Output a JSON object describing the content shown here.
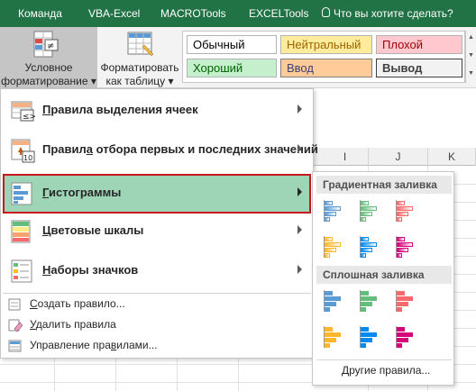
{
  "tabs": [
    {
      "label": "Команда"
    },
    {
      "label": "VBA-Excel"
    },
    {
      "label": "MACROTools"
    },
    {
      "label": "EXCELTools"
    }
  ],
  "tell_me": "Что вы хотите сделать?",
  "ribbon": {
    "conditional_formatting": {
      "line1": "Условное",
      "line2": "форматирование ▾"
    },
    "format_as_table": {
      "line1": "Форматировать",
      "line2": "как таблицу ▾"
    },
    "cell_styles": [
      {
        "label": "Обычный",
        "bg": "#ffffff",
        "color": "#000000"
      },
      {
        "label": "Нейтральный",
        "bg": "#ffeb9c",
        "color": "#9c6500"
      },
      {
        "label": "Плохой",
        "bg": "#ffc7ce",
        "color": "#9c0006"
      },
      {
        "label": "Хороший",
        "bg": "#c6efce",
        "color": "#006100"
      },
      {
        "label": "Ввод",
        "bg": "#ffcc99",
        "color": "#3f3f76"
      },
      {
        "label": "Вывод",
        "bg": "#f2f2f2",
        "color": "#3f3f3f"
      }
    ]
  },
  "sheet": {
    "columns": [
      {
        "label": "I"
      },
      {
        "label": "J"
      },
      {
        "label": "K"
      }
    ]
  },
  "menu": {
    "items": [
      {
        "label": "Правила выделения ячеек",
        "icon": "highlight-rules-icon"
      },
      {
        "label": "Правила отбора первых и последних значений",
        "icon": "top-bottom-rules-icon",
        "icon_text": "10"
      },
      {
        "label": "Гистограммы",
        "icon": "data-bars-icon"
      },
      {
        "label": "Цветовые шкалы",
        "icon": "color-scales-icon"
      },
      {
        "label": "Наборы значков",
        "icon": "icon-sets-icon"
      }
    ],
    "small_items": [
      {
        "label": "Создать правило...",
        "icon": "new-rule-icon"
      },
      {
        "label": "Удалить правила",
        "icon": "clear-rules-icon"
      },
      {
        "label": "Управление правилами...",
        "icon": "manage-rules-icon"
      }
    ]
  },
  "submenu": {
    "gradient_title": "Градиентная заливка",
    "solid_title": "Сплошная заливка",
    "bar_colors": [
      "#5b9bd5",
      "#63be7b",
      "#f8696b",
      "#ffb628",
      "#008aef",
      "#d6007b"
    ],
    "more_rules": "Другие правила..."
  },
  "colors": {
    "accent_green": "#217346",
    "selected_bg": "#9fd5b7",
    "selected_border": "#c8171c"
  }
}
